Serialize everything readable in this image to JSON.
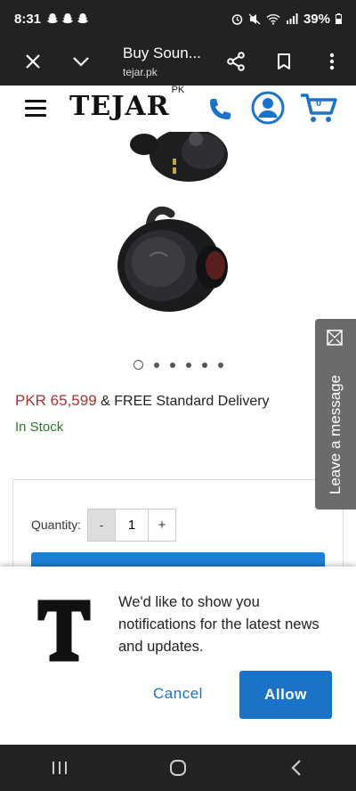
{
  "status_bar": {
    "time": "8:31",
    "notification_icons": [
      "snapchat-icon",
      "snapchat-icon",
      "snapchat-icon"
    ],
    "system_icons": [
      "alarm-icon",
      "mute-icon",
      "wifi-icon",
      "signal-icon"
    ],
    "battery": "39%"
  },
  "browser": {
    "title": "Buy Soun...",
    "url": "tejar.pk",
    "icons": [
      "close-icon",
      "chevron-down-icon",
      "share-icon",
      "bookmark-icon",
      "more-vert-icon"
    ]
  },
  "site_header": {
    "logo": "TEJAR",
    "logo_suffix": "PK",
    "cart_count": "0",
    "icons": [
      "hamburger-menu-icon",
      "phone-icon",
      "account-icon",
      "cart-icon"
    ]
  },
  "product": {
    "image_dots": 6,
    "active_dot": 0,
    "price": "PKR 65,599",
    "delivery": "& FREE Standard Delivery",
    "stock": "In Stock"
  },
  "purchase": {
    "quantity_label": "Quantity:",
    "minus": "-",
    "quantity": "1",
    "plus": "+"
  },
  "chat_tab": {
    "label": "Leave a message"
  },
  "notification_prompt": {
    "logo_letter": "T",
    "message": "We'd like to show you notifications for the latest news and updates.",
    "cancel": "Cancel",
    "allow": "Allow"
  },
  "nav_bar": {
    "icons": [
      "recent-apps-icon",
      "home-icon",
      "back-icon"
    ]
  },
  "colors": {
    "accent": "#1a73c8",
    "price": "#aa3333",
    "stock": "#2a7a2a",
    "bars": "#222222"
  }
}
